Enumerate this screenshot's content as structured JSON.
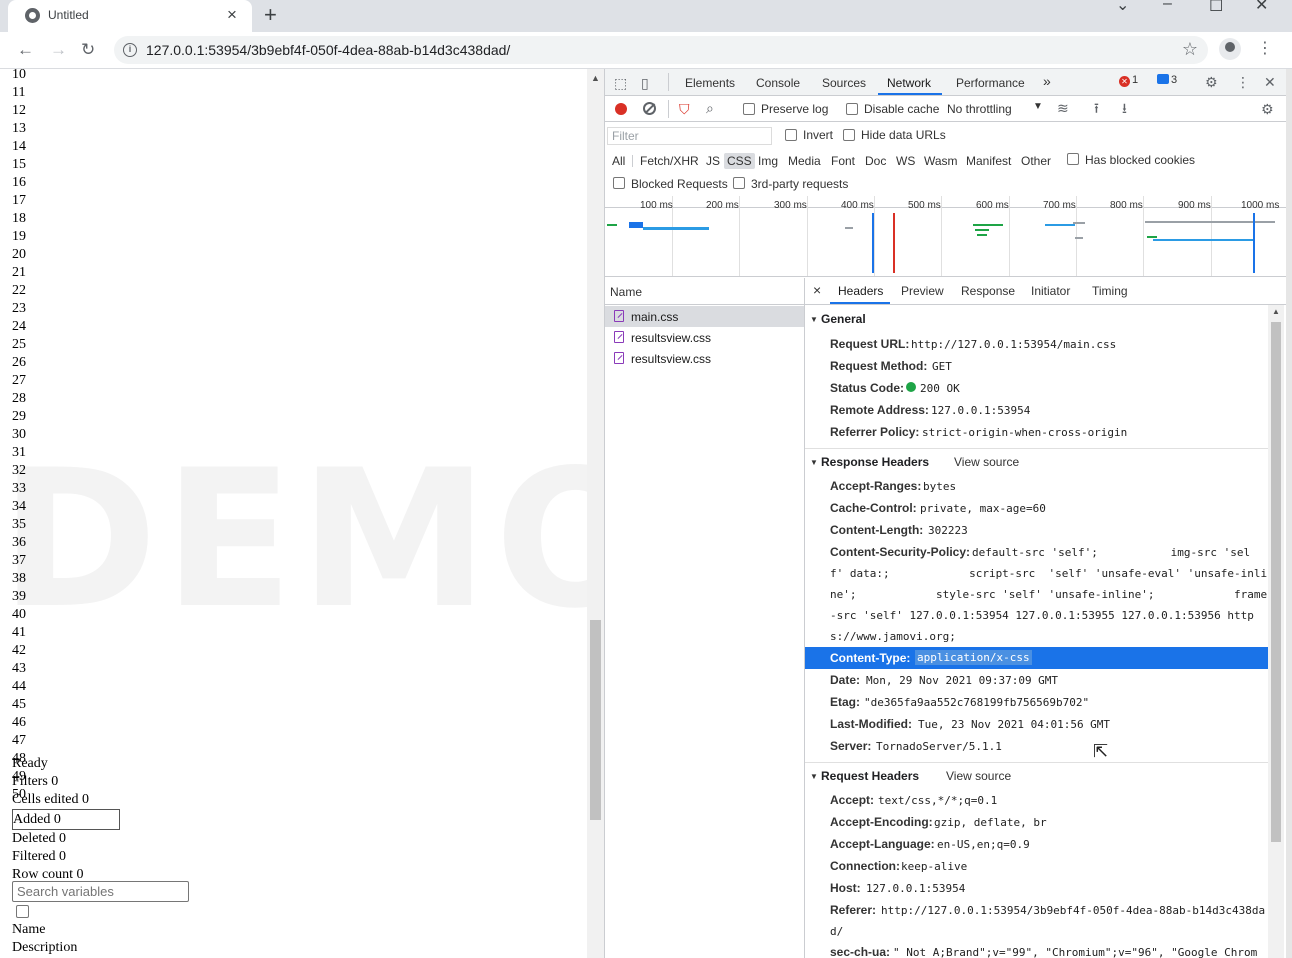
{
  "browser": {
    "tab_title": "Untitled",
    "url": "127.0.0.1:53954/3b9ebf4f-050f-4dea-88ab-b14d3c438dad/",
    "new_tab_symbol": "+",
    "close_tab_symbol": "×"
  },
  "page": {
    "watermark": "DEMO VERS",
    "row_numbers": [
      "10",
      "11",
      "12",
      "13",
      "14",
      "15",
      "16",
      "17",
      "18",
      "19",
      "20",
      "21",
      "22",
      "23",
      "24",
      "25",
      "26",
      "27",
      "28",
      "29",
      "30",
      "31",
      "32",
      "33",
      "34",
      "35",
      "36",
      "37",
      "38",
      "39",
      "40",
      "41",
      "42",
      "43",
      "44",
      "45",
      "46",
      "47",
      "48",
      "49",
      "50"
    ],
    "status": {
      "ready": "Ready",
      "filters": "Filters 0",
      "cells_edited": "Cells edited 0",
      "added": "Added 0",
      "deleted": "Deleted 0",
      "filtered": "Filtered 0",
      "row_count": "Row count 0"
    },
    "search_placeholder": "Search variables",
    "col_name": "Name",
    "col_description": "Description"
  },
  "devtools": {
    "tabs": [
      "Elements",
      "Console",
      "Sources",
      "Network",
      "Performance"
    ],
    "active_tab": "Network",
    "more_tabs": "»",
    "error_count": "1",
    "message_count": "3",
    "toolbar": {
      "preserve_log": "Preserve log",
      "disable_cache": "Disable cache",
      "throttling": "No throttling"
    },
    "filter": {
      "placeholder": "Filter",
      "invert": "Invert",
      "hide_data_urls": "Hide data URLs",
      "types": [
        "All",
        "Fetch/XHR",
        "JS",
        "CSS",
        "Img",
        "Media",
        "Font",
        "Doc",
        "WS",
        "Wasm",
        "Manifest",
        "Other"
      ],
      "active_type": "CSS",
      "has_blocked_cookies": "Has blocked cookies",
      "blocked_requests": "Blocked Requests",
      "third_party": "3rd-party requests"
    },
    "timeline_ticks": [
      "100 ms",
      "200 ms",
      "300 ms",
      "400 ms",
      "500 ms",
      "600 ms",
      "700 ms",
      "800 ms",
      "900 ms",
      "1000 ms"
    ],
    "requests": {
      "header": "Name",
      "items": [
        "main.css",
        "resultsview.css",
        "resultsview.css"
      ]
    },
    "detail_tabs": [
      "Headers",
      "Preview",
      "Response",
      "Initiator",
      "Timing"
    ],
    "detail_close": "×",
    "general": {
      "title": "General",
      "request_url_label": "Request URL:",
      "request_url": "http://127.0.0.1:53954/main.css",
      "method_label": "Request Method:",
      "method": "GET",
      "status_label": "Status Code:",
      "status": "200 OK",
      "status_color": "#1ea446",
      "remote_label": "Remote Address:",
      "remote": "127.0.0.1:53954",
      "referrer_label": "Referrer Policy:",
      "referrer": "strict-origin-when-cross-origin"
    },
    "response_headers": {
      "title": "Response Headers",
      "view_source": "View source",
      "accept_ranges_label": "Accept-Ranges:",
      "accept_ranges": "bytes",
      "cache_control_label": "Cache-Control:",
      "cache_control": "private, max-age=60",
      "content_length_label": "Content-Length:",
      "content_length": "302223",
      "csp_label": "Content-Security-Policy:",
      "csp_line1": "default-src 'self';           img-src 'sel",
      "csp_line2": "f' data:;            script-src  'self' 'unsafe-eval' 'unsafe-inli",
      "csp_line3": "ne';            style-src 'self' 'unsafe-inline';            frame",
      "csp_line4": "-src 'self' 127.0.0.1:53954 127.0.0.1:53955 127.0.0.1:53956 http",
      "csp_line5": "s://www.jamovi.org;",
      "content_type_label": "Content-Type:",
      "content_type": "application/x-css",
      "date_label": "Date:",
      "date": "Mon, 29 Nov 2021 09:37:09 GMT",
      "etag_label": "Etag:",
      "etag": "\"de365fa9aa552c768199fb756569b702\"",
      "last_modified_label": "Last-Modified:",
      "last_modified": "Tue, 23 Nov 2021 04:01:56 GMT",
      "server_label": "Server:",
      "server": "TornadoServer/5.1.1"
    },
    "request_headers": {
      "title": "Request Headers",
      "view_source": "View source",
      "accept_label": "Accept:",
      "accept": "text/css,*/*;q=0.1",
      "accept_encoding_label": "Accept-Encoding:",
      "accept_encoding": "gzip, deflate, br",
      "accept_language_label": "Accept-Language:",
      "accept_language": "en-US,en;q=0.9",
      "connection_label": "Connection:",
      "connection": "keep-alive",
      "host_label": "Host:",
      "host": "127.0.0.1:53954",
      "referer_label": "Referer:",
      "referer_line1": "http://127.0.0.1:53954/3b9ebf4f-050f-4dea-88ab-b14d3c438da",
      "referer_line2": "d/",
      "sec_ch_ua_label": "sec-ch-ua:",
      "sec_ch_ua": "\" Not A;Brand\";v=\"99\", \"Chromium\";v=\"96\", \"Google Chrom"
    }
  }
}
